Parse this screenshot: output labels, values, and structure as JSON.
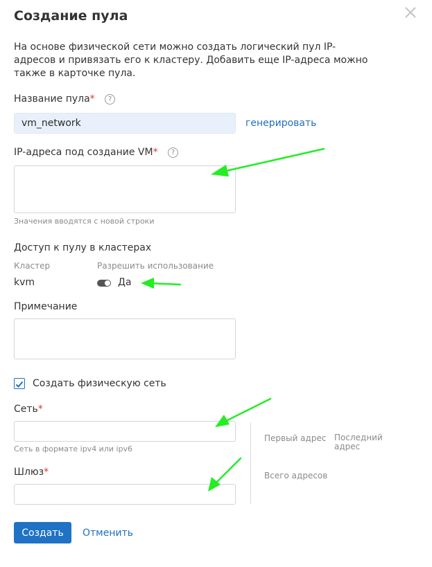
{
  "dialog": {
    "title": "Создание пула",
    "description": "На основе физической сети можно создать логический пул IP-адресов и привязать его к кластеру. Добавить еще IP-адреса можно также в карточке пула."
  },
  "pool_name": {
    "label": "Название пула",
    "required_mark": "*",
    "help": "?",
    "value": "vm_network",
    "generate_link": "генерировать"
  },
  "ip_addresses": {
    "label": "IP-адреса под создание VM",
    "required_mark": "*",
    "help": "?",
    "value": "",
    "hint": "Значения вводятся с новой строки"
  },
  "cluster_access": {
    "heading": "Доступ к пулу в кластерах",
    "col_cluster": "Кластер",
    "col_allow": "Разрешить использование",
    "rows": [
      {
        "cluster": "kvm",
        "allow_label": "Да"
      }
    ]
  },
  "note": {
    "label": "Примечание",
    "value": ""
  },
  "physical_network": {
    "checkbox_label": "Создать физическую сеть",
    "checked": true
  },
  "network": {
    "label": "Сеть",
    "required_mark": "*",
    "value": "",
    "hint": "Сеть в формате ipv4 или ipv6"
  },
  "gateway": {
    "label": "Шлюз",
    "required_mark": "*",
    "value": ""
  },
  "address_info": {
    "first_address": "Первый адрес",
    "last_address": "Последний адрес",
    "total_addresses": "Всего адресов"
  },
  "actions": {
    "create": "Создать",
    "cancel": "Отменить"
  },
  "colors": {
    "primary": "#1f72c4",
    "link": "#1f6fbf",
    "required": "#dd3333",
    "annotation_arrow": "#22ee22",
    "filled_input": "#e8f0fb"
  }
}
